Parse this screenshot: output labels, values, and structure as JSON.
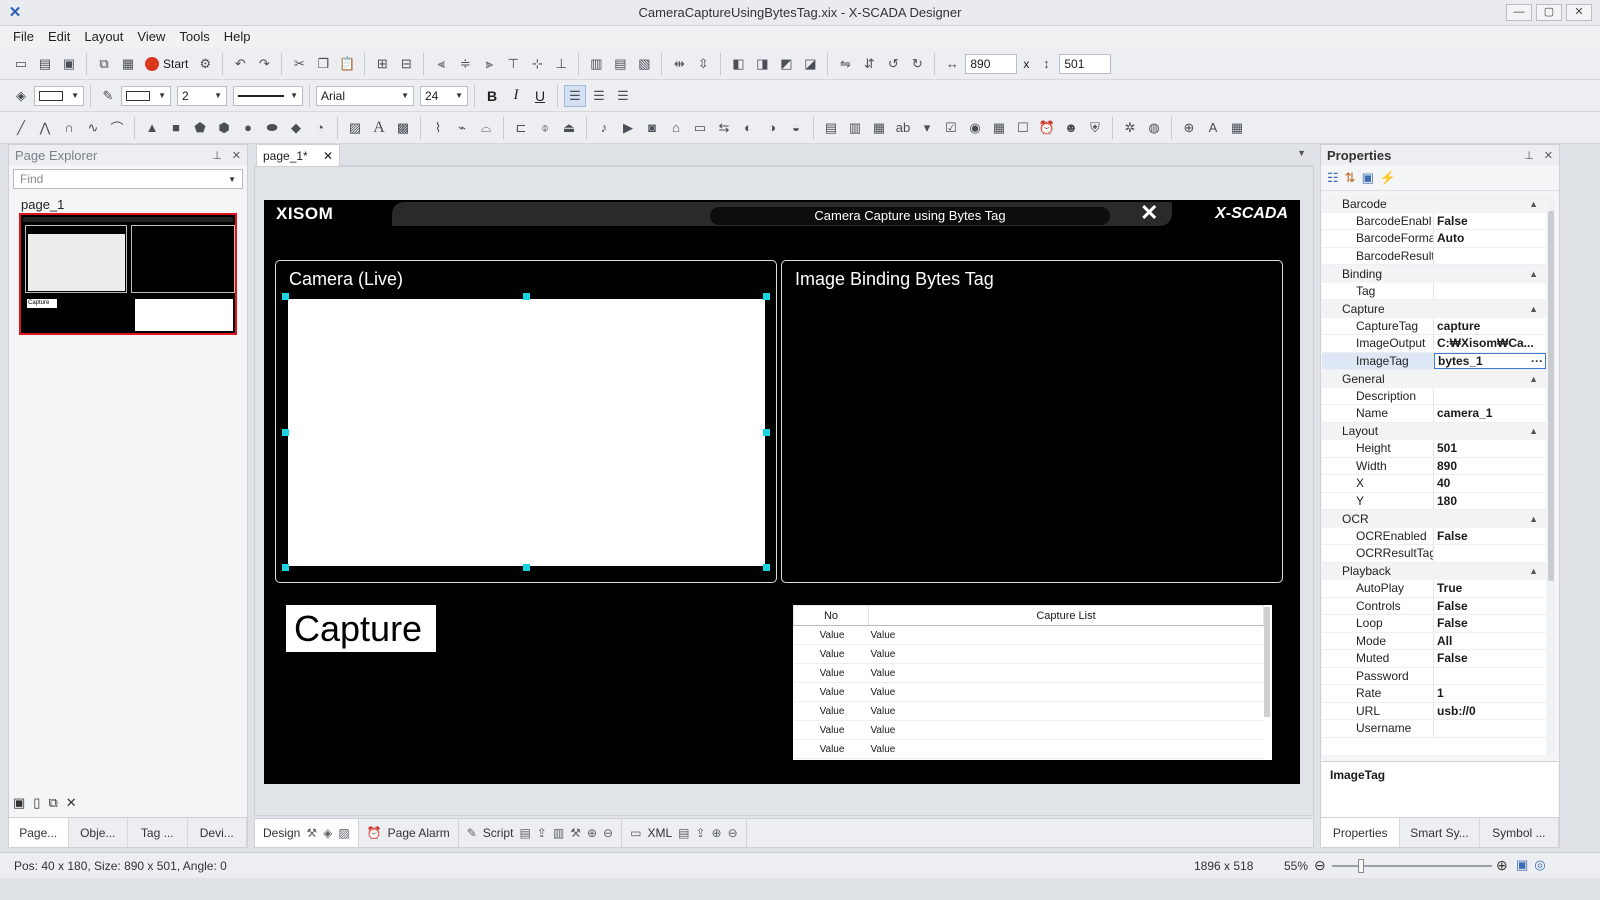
{
  "window": {
    "title": "CameraCaptureUsingBytesTag.xix - X-SCADA Designer",
    "minimize": "—",
    "maximize": "▢",
    "close": "✕"
  },
  "menu": [
    "File",
    "Edit",
    "Layout",
    "View",
    "Tools",
    "Help"
  ],
  "toolbar": {
    "start_label": "Start",
    "width_value": "890",
    "times": "x",
    "height_value": "501",
    "font_name": "Arial",
    "font_size": "24",
    "line_width": "2",
    "bold": "B",
    "italic": "I",
    "underline": "U"
  },
  "page_explorer": {
    "title": "Page Explorer",
    "find_placeholder": "Find",
    "page_label": "page_1",
    "thumb_capture": "Capture",
    "tabs": [
      "Page...",
      "Obje...",
      "Tag ...",
      "Devi..."
    ]
  },
  "doc": {
    "tab_label": "page_1*"
  },
  "page": {
    "brand_left": "XISOM",
    "header_title": "Camera Capture using Bytes Tag",
    "brand_right": "X-SCADA",
    "close_glyph": "✕",
    "camera_title": "Camera (Live)",
    "image_title": "Image Binding Bytes Tag",
    "capture_button": "Capture",
    "table": {
      "headers": [
        "No",
        "Capture List"
      ],
      "rows": [
        [
          "Value",
          "Value"
        ],
        [
          "Value",
          "Value"
        ],
        [
          "Value",
          "Value"
        ],
        [
          "Value",
          "Value"
        ],
        [
          "Value",
          "Value"
        ],
        [
          "Value",
          "Value"
        ],
        [
          "Value",
          "Value"
        ]
      ]
    }
  },
  "center_tabs": [
    "Design",
    "Page Alarm",
    "Script",
    "XML"
  ],
  "properties": {
    "title": "Properties",
    "categories": [
      {
        "name": "Barcode",
        "rows": [
          [
            "BarcodeEnabl",
            "False"
          ],
          [
            "BarcodeForma",
            "Auto"
          ],
          [
            "BarcodeResult",
            ""
          ]
        ]
      },
      {
        "name": "Binding",
        "rows": [
          [
            "Tag",
            ""
          ]
        ]
      },
      {
        "name": "Capture",
        "rows": [
          [
            "CaptureTag",
            "capture"
          ],
          [
            "ImageOutput",
            "C:₩Xisom₩Ca..."
          ],
          [
            "ImageTag",
            "bytes_1"
          ]
        ]
      },
      {
        "name": "General",
        "rows": [
          [
            "Description",
            ""
          ],
          [
            "Name",
            "camera_1"
          ]
        ]
      },
      {
        "name": "Layout",
        "rows": [
          [
            "Height",
            "501"
          ],
          [
            "Width",
            "890"
          ],
          [
            "X",
            "40"
          ],
          [
            "Y",
            "180"
          ]
        ]
      },
      {
        "name": "OCR",
        "rows": [
          [
            "OCREnabled",
            "False"
          ],
          [
            "OCRResultTag",
            ""
          ]
        ]
      },
      {
        "name": "Playback",
        "rows": [
          [
            "AutoPlay",
            "True"
          ],
          [
            "Controls",
            "False"
          ],
          [
            "Loop",
            "False"
          ],
          [
            "Mode",
            "All"
          ],
          [
            "Muted",
            "False"
          ],
          [
            "Password",
            ""
          ],
          [
            "Rate",
            "1"
          ],
          [
            "URL",
            "usb://0"
          ],
          [
            "Username",
            ""
          ]
        ]
      }
    ],
    "selected_key": "ImageTag",
    "description": "ImageTag",
    "tabs": [
      "Properties",
      "Smart Sy...",
      "Symbol ..."
    ]
  },
  "status": {
    "info": "Pos: 40 x 180, Size: 890 x 501, Angle: 0",
    "canvas_size": "1896 x 518",
    "zoom": "55%",
    "zoom_level": 0.18
  }
}
